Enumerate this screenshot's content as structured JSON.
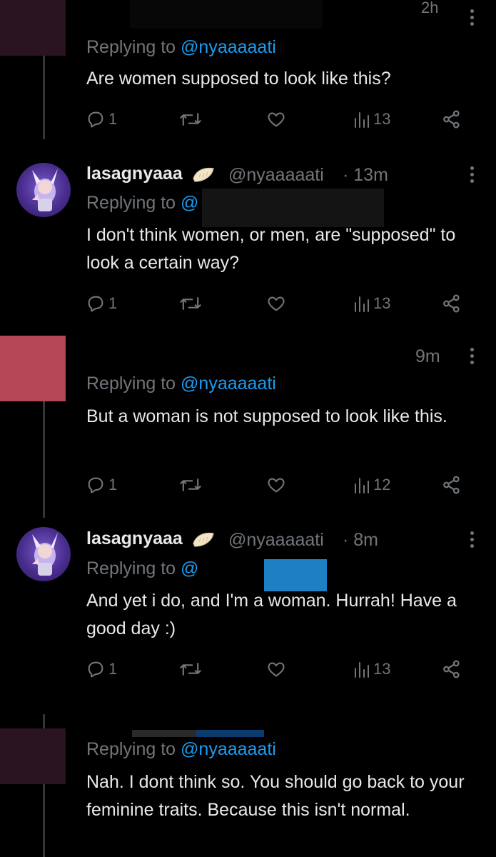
{
  "tweets": [
    {
      "reply_prefix": "Replying to",
      "mention": "@nyaaaaati",
      "text": "Are women supposed to look like this?",
      "time": "2h",
      "stats": {
        "replies": "1",
        "views": "13"
      }
    },
    {
      "name": "lasagnyaaa",
      "handle": "@nyaaaaati",
      "time": "· 13m",
      "reply_prefix": "Replying to",
      "mention": "@",
      "text": "I don't think women, or men, are \"supposed\" to look a certain way?",
      "stats": {
        "replies": "1",
        "views": "13"
      }
    },
    {
      "time": "9m",
      "reply_prefix": "Replying to",
      "mention": "@nyaaaaati",
      "text": "But  a woman is not supposed to look like this.",
      "stats": {
        "replies": "1",
        "views": "12"
      }
    },
    {
      "name": "lasagnyaaa",
      "handle": "@nyaaaaati",
      "time": "· 8m",
      "reply_prefix": "Replying to",
      "mention": "@",
      "text": "And yet i do, and I'm a woman. Hurrah! Have a good day :)",
      "stats": {
        "replies": "1",
        "views": "13"
      }
    },
    {
      "reply_prefix": "Replying to",
      "mention": "@nyaaaaati",
      "text": "Nah. I dont think so. You should go back to your feminine traits. Because this isn't normal."
    }
  ],
  "icons": {
    "reply": "reply-icon",
    "retweet": "retweet-icon",
    "like": "like-icon",
    "views": "views-icon",
    "share": "share-icon",
    "more": "more-icon",
    "name_emoji": "dumpling-emoji-icon"
  },
  "colors": {
    "background": "#000000",
    "text": "#e7e9ea",
    "muted": "#71767b",
    "link": "#1d9bf0",
    "thread_line": "#333639"
  }
}
